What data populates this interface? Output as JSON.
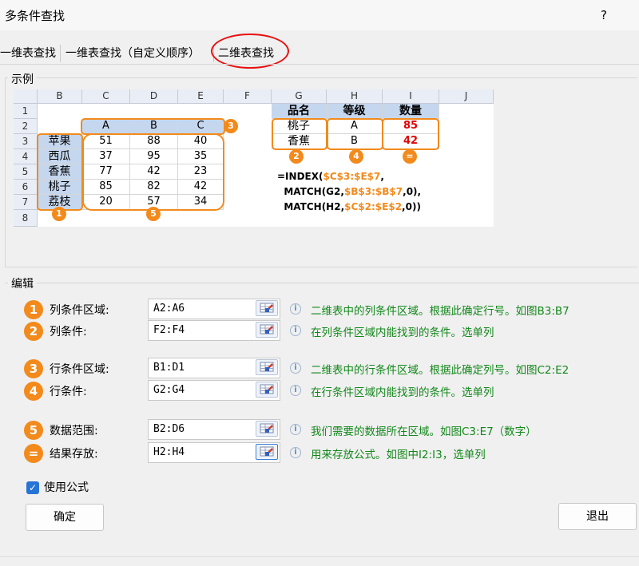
{
  "window": {
    "title": "多条件查找",
    "help": "?"
  },
  "tabs": [
    {
      "label": "一维表查找",
      "active": false
    },
    {
      "label": "一维表查找（自定义顺序）",
      "active": false
    },
    {
      "label": "二维表查找",
      "active": true
    }
  ],
  "example": {
    "group_label": "示例",
    "col_headers": [
      "B",
      "C",
      "D",
      "E",
      "F",
      "G",
      "H",
      "I",
      "J"
    ],
    "row_headers": [
      "1",
      "2",
      "3",
      "4",
      "5",
      "6",
      "7",
      "8"
    ],
    "col_conditions": [
      "A",
      "B",
      "C"
    ],
    "row_labels": [
      "苹果",
      "西瓜",
      "香蕉",
      "桃子",
      "荔枝"
    ],
    "data_rows": [
      [
        "51",
        "88",
        "40"
      ],
      [
        "37",
        "95",
        "35"
      ],
      [
        "77",
        "42",
        "23"
      ],
      [
        "85",
        "82",
        "42"
      ],
      [
        "20",
        "57",
        "34"
      ]
    ],
    "lookup_headers": [
      "品名",
      "等级",
      "数量"
    ],
    "lookup_rows": [
      [
        "桃子",
        "A",
        "85"
      ],
      [
        "香蕉",
        "B",
        "42"
      ]
    ],
    "markers": [
      "1",
      "2",
      "3",
      "4",
      "5",
      "="
    ],
    "formula": {
      "l1a": "=INDEX(",
      "l1b": "$C$3:$E$7",
      "l1c": ",",
      "l2a": "MATCH(G2,",
      "l2b": "$B$3:$B$7",
      "l2c": ",0),",
      "l3a": "MATCH(H2,",
      "l3b": "$C$2:$E$2",
      "l3c": ",0))"
    },
    "colors": {
      "accent": "#f28a1c",
      "result": "#e40000",
      "condition_fill": "#c5d7ee",
      "active_tab_circle": "#e81010"
    }
  },
  "edit": {
    "group_label": "编辑",
    "rows": [
      {
        "num": "1",
        "label": "列条件区域:",
        "value": "A2:A6",
        "desc": "二维表中的列条件区域。根据此确定行号。如图B3:B7"
      },
      {
        "num": "2",
        "label": "列条件:",
        "value": "F2:F4",
        "desc": "在列条件区域内能找到的条件。选单列"
      },
      {
        "num": "3",
        "label": "行条件区域:",
        "value": "B1:D1",
        "desc": "二维表中的行条件区域。根据此确定列号。如图C2:E2"
      },
      {
        "num": "4",
        "label": "行条件:",
        "value": "G2:G4",
        "desc": "在行条件区域内能找到的条件。选单列"
      },
      {
        "num": "5",
        "label": "数据范围:",
        "value": "B2:D6",
        "desc": "我们需要的数据所在区域。如图C3:E7（数字）"
      },
      {
        "num": "=",
        "label": "结果存放:",
        "value": "H2:H4",
        "desc": "用来存放公式。如图中I2:I3，选单列"
      }
    ],
    "use_formula": {
      "label": "使用公式",
      "checked": true
    }
  },
  "buttons": {
    "ok": "确定",
    "exit": "退出"
  },
  "icons": {
    "picker": "range-picker-icon",
    "info": "info-icon"
  }
}
